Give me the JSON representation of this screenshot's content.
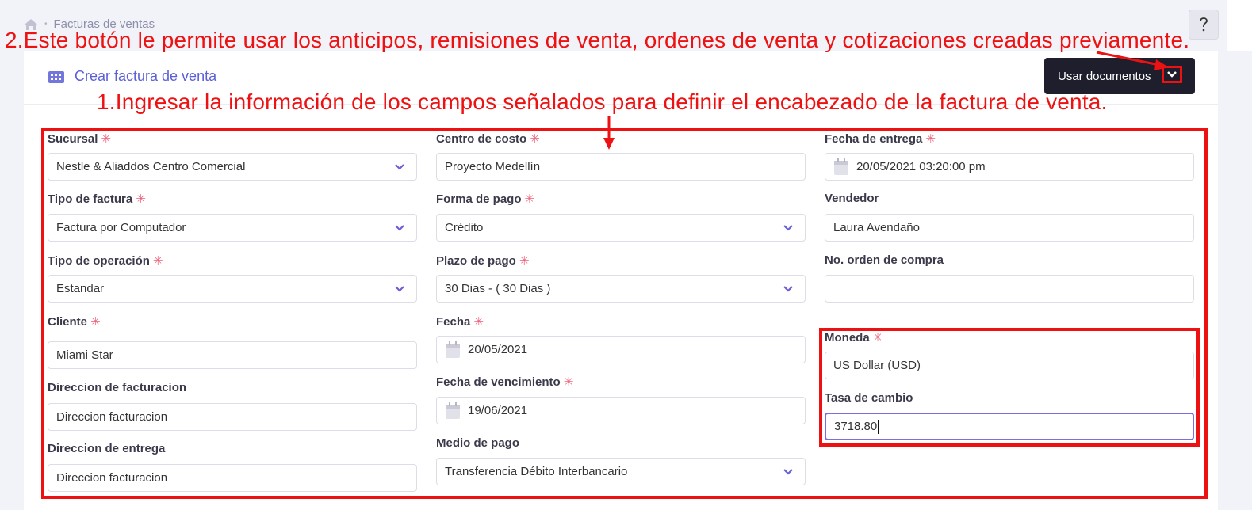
{
  "breadcrumb": {
    "section": "Facturas de ventas"
  },
  "header": {
    "title": "Crear factura de venta",
    "use_docs_label": "Usar documentos",
    "help_icon": "question-mark-icon"
  },
  "annotations": {
    "step2": "2.Este botón le permite usar los anticipos, remisiones de venta, ordenes de venta y cotizaciones creadas previamente.",
    "step1": "1.Ingresar la información de los campos señalados para definir el encabezado de la factura de venta."
  },
  "form": {
    "required_mark": "✳",
    "sucursal": {
      "label": "Sucursal",
      "value": "Nestle & Aliaddos Centro Comercial"
    },
    "tipo_factura": {
      "label": "Tipo de factura",
      "value": "Factura por Computador"
    },
    "tipo_operacion": {
      "label": "Tipo de operación",
      "value": "Estandar"
    },
    "cliente": {
      "label": "Cliente",
      "value": "Miami Star"
    },
    "dir_facturacion": {
      "label": "Direccion de facturacion",
      "value": "Direccion facturacion"
    },
    "dir_entrega": {
      "label": "Direccion de entrega",
      "value": "Direccion facturacion"
    },
    "centro_costo": {
      "label": "Centro de costo",
      "value": "Proyecto Medellín"
    },
    "forma_pago": {
      "label": "Forma de pago",
      "value": "Crédito"
    },
    "plazo_pago": {
      "label": "Plazo de pago",
      "value": "30 Dias - ( 30 Dias )"
    },
    "fecha": {
      "label": "Fecha",
      "value": "20/05/2021"
    },
    "fecha_vencimiento": {
      "label": "Fecha de vencimiento",
      "value": "19/06/2021"
    },
    "medio_pago": {
      "label": "Medio de pago",
      "value": "Transferencia Débito Interbancario"
    },
    "fecha_entrega": {
      "label": "Fecha de entrega",
      "value": "20/05/2021 03:20:00 pm"
    },
    "vendedor": {
      "label": "Vendedor",
      "value": "Laura Avendaño"
    },
    "orden_compra": {
      "label": "No. orden de compra",
      "value": ""
    },
    "moneda": {
      "label": "Moneda",
      "value": "US Dollar (USD)"
    },
    "tasa_cambio": {
      "label": "Tasa de cambio",
      "value": "3718.80"
    }
  },
  "colors": {
    "accent": "#5b5fd6",
    "annotation": "#ee1111",
    "button_dark": "#1e1e2d",
    "required": "#f0607a"
  }
}
